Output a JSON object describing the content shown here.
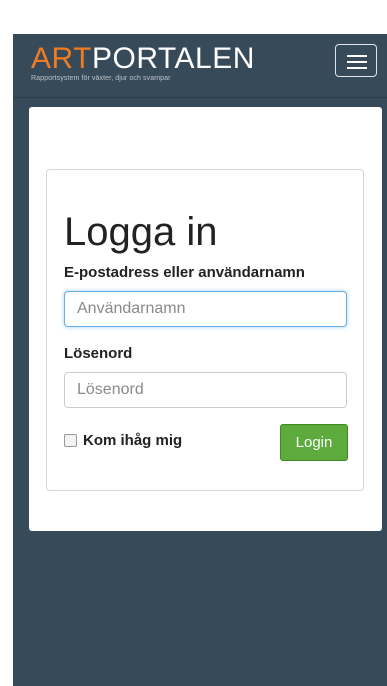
{
  "navbar": {
    "brand_art": "ART",
    "brand_portalen": "PORTALEN",
    "tagline": "Rapportsystem för växter, djur och svampar",
    "menu_icon": "hamburger-menu-icon"
  },
  "login": {
    "title": "Logga in",
    "username_label": "E-postadress eller användarnamn",
    "username_placeholder": "Användarnamn",
    "password_label": "Lösenord",
    "password_placeholder": "Lösenord",
    "remember_label": "Kom ihåg mig",
    "remember_checked": false,
    "submit_label": "Login"
  },
  "colors": {
    "background": "#374a59",
    "brand_accent": "#f07c21",
    "button_green": "#5cab3c",
    "focus_border": "#66afe9"
  }
}
